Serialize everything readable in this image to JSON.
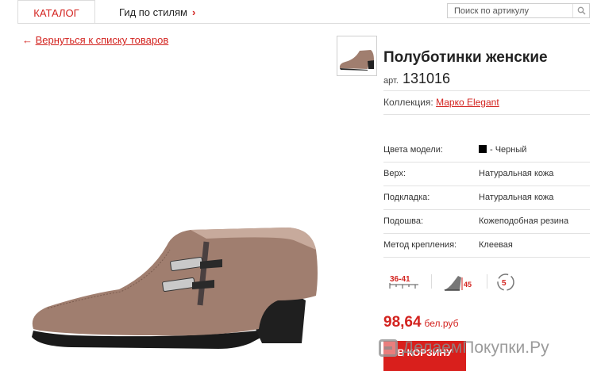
{
  "nav": {
    "catalog_tab": "КАТАЛОГ",
    "style_guide_tab": "Гид по стилям",
    "search_placeholder": "Поиск по артикулу"
  },
  "back_link": {
    "arrow": "←",
    "label": "Вернуться к списку товаров"
  },
  "product": {
    "title": "Полуботинки женские",
    "article_prefix": "арт.",
    "article_number": "131016",
    "collection_label": "Коллекция:",
    "collection_value": "Марко Elegant",
    "specs": [
      {
        "key": "Цвета модели:",
        "value": "- Черный",
        "swatch_color": "#000000"
      },
      {
        "key": "Верх:",
        "value": "Натуральная кожа"
      },
      {
        "key": "Подкладка:",
        "value": "Натуральная кожа"
      },
      {
        "key": "Подошва:",
        "value": "Кожеподобная резина"
      },
      {
        "key": "Метод крепления:",
        "value": "Клеевая"
      }
    ],
    "feature_icons": {
      "size_range": "36-41",
      "heel_height": "45",
      "width_fit": "5"
    },
    "price": "98,64",
    "currency": "бел.руб",
    "buy_button": "В КОРЗИНУ"
  },
  "watermark": {
    "text": "ДелаемПокупки.Ру"
  },
  "colors": {
    "accent": "#d3231f",
    "border": "#dcdcdc",
    "shoe": "#a07e6f"
  },
  "icons": {
    "search": "search-icon",
    "chevron": "chevron-right-icon",
    "size": "shoe-size-icon",
    "heel": "heel-height-icon",
    "fit": "width-fit-icon"
  }
}
